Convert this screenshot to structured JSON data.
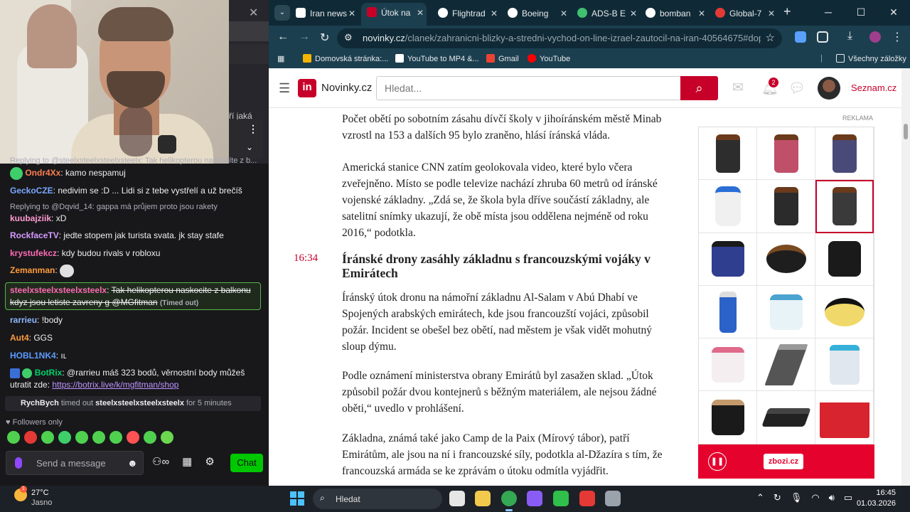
{
  "chat": {
    "pinned_fragment": "ří jaká",
    "pinned_menu_icon": "more-vertical-icon",
    "messages": [
      {
        "reply_to": "Replying to @steelxsteelxsteelxsteelx: Tak helikopterou naskočíte z b...",
        "user": "Ondr4Xx",
        "color": "#ff7f50",
        "text": "kamo nespamuj"
      },
      {
        "user": "GeckoCZE",
        "color": "#7aa7ff",
        "text": "nedivim se :D ... Lidi si z tebe vystřelí a už brečíš"
      },
      {
        "reply_to": "Replying to @Dqvid_14: gappa má průjem proto jsou rakety",
        "user": "kuubajziik",
        "color": "#ff9bd1",
        "text": "xD"
      },
      {
        "user": "RockfaceTV",
        "color": "#d59bff",
        "text": "jedte stopem jak turista svata. jk stay stafe"
      },
      {
        "user": "krystufekcz",
        "color": "#ff6bb5",
        "text": "kdy budou rivals v robloxu"
      },
      {
        "user": "Zemanman",
        "color": "#ff9b3a",
        "text": ""
      },
      {
        "user": "rarrieu",
        "color": "#8fb8ff",
        "text": "!body"
      },
      {
        "user": "Aut4",
        "color": "#ff9b3a",
        "text": "GGS"
      },
      {
        "user": "HOBL1NK4",
        "color": "#5c9bff",
        "text": "ıʟ"
      }
    ],
    "highlight": {
      "user": "steelxsteelxsteelxsteelx",
      "color": "#ff69b4",
      "text_line1": "Tak helikopterou naskocite z balkonu",
      "text_line2": "kdyz jsou letiste zavreny g @MGfitman",
      "tag": "(Timed out)"
    },
    "botrix": {
      "user": "BotRix",
      "color": "#00d26a",
      "text": "@rarrieu máš 323 bodů, věrnostní body můžeš",
      "text2": "utratit zde:",
      "link": "https://botrix.live/k/mgfitman/shop"
    },
    "timeout_notice": {
      "user": "RychBych",
      "mid": "timed out",
      "target": "steelxsteelxsteelxsteelx",
      "tail": "for 5 minutes"
    },
    "followers_only": "Followers only",
    "input_placeholder": "Send a message",
    "chat_button": "Chat",
    "icons": [
      "emote-picker-icon",
      "bits-icon",
      "store-icon",
      "settings-icon"
    ],
    "emote_colors": [
      "#4fd14f",
      "#e53935",
      "#4fd14f",
      "#3ecf6b",
      "#4fd14f",
      "#4fd14f",
      "#4fd14f",
      "#ff5252",
      "#4fd14f",
      "#6bd84f"
    ]
  },
  "browser": {
    "tabs": [
      {
        "label": "Iran news",
        "fav_color": "#ffffff"
      },
      {
        "label": "Útok na",
        "fav_color": "#c7002a",
        "active": true
      },
      {
        "label": "Flightrad",
        "fav_color": "#ffffff"
      },
      {
        "label": "Boeing",
        "fav_color": "#ffffff"
      },
      {
        "label": "ADS-B E",
        "fav_color": "#3fbf6f"
      },
      {
        "label": "bomban",
        "fav_color": "#ffffff"
      },
      {
        "label": "Global-7",
        "fav_color": "#e53935"
      }
    ],
    "url_host": "novinky.cz",
    "url_path": "/clanek/zahranicni-blizky-a-stredni-vychod-on-line-izrael-zautocil-na-iran-40564675#dop_ab_va...",
    "bookmarks": [
      {
        "label": "Domovská stránka:...",
        "color": "#f4b400"
      },
      {
        "label": "YouTube to MP4 &...",
        "color": "#ffffff"
      },
      {
        "label": "Gmail",
        "color": "#ea4335"
      },
      {
        "label": "YouTube",
        "color": "#ff0000"
      }
    ],
    "bookmarks_all": "Všechny záložky"
  },
  "site": {
    "logo_letters": "in",
    "logo_text": "Novinky.cz",
    "search_placeholder": "Hledat...",
    "notifications": "2",
    "seznam": "Seznam.cz"
  },
  "article": {
    "p1": "Počet obětí po sobotním zásahu dívčí školy v jihoíránském městě Minab vzrostl na 153 a dalších 95 bylo zraněno, hlásí íránská vláda.",
    "p2": "Americká stanice CNN zatím geolokovala video, které bylo včera zveřejněno. Místo se podle televize nachází zhruba 60 metrů od íránské vojenské základny. „Zdá se, že škola byla dříve součástí základny, ale satelitní snímky ukazují, že obě místa jsou oddělena nejméně od roku 2016,“ podotkla.",
    "time": "16:34",
    "headline": "Íránské drony zasáhly základnu s francouzskými vojáky v Emirátech",
    "p3": "Íránský útok dronu na námořní základnu Al-Salam v Abú Dhabí ve Spojených arabských emirátech, kde jsou francouzští vojáci, způsobil požár. Incident se obešel bez obětí, nad městem je však vidět mohutný sloup dýmu.",
    "p4": "Podle oznámení ministerstva obrany Emirátů byl zasažen sklad. „Útok způsobil požár dvou kontejnerů s běžným materiálem, ale nejsou žádné oběti,“ uvedlo v prohlášení.",
    "p5": "Základna, známá také jako Camp de la Paix (Mírový tábor), patří Emirátům, ale jsou na ní i francouzské síly, podotkla al-Džazíra s tím, že francouzská armáda se ke zprávám o útoku odmítla vyjádřit."
  },
  "ad": {
    "label": "REKLAMA",
    "brand": "zbozi.cz",
    "products": [
      {
        "kind": "jar",
        "color": "#2d2d2d",
        "lid": "#6a3a1a"
      },
      {
        "kind": "jar",
        "color": "#c0506a",
        "lid": "#6a3a1a"
      },
      {
        "kind": "jar",
        "color": "#4a4a78",
        "lid": "#6a3a1a"
      },
      {
        "kind": "bottle",
        "color": "#f0f0f0",
        "lid": "#2a6fd6"
      },
      {
        "kind": "jar",
        "color": "#2b2b2b",
        "lid": "#6a3a1a"
      },
      {
        "kind": "jar",
        "color": "#3a3a3a",
        "lid": "#6a3a1a"
      },
      {
        "kind": "tub",
        "color": "#2f3e8f",
        "lid": "#1a1a1a"
      },
      {
        "kind": "round",
        "color": "#1e1e1e",
        "lid": "#7a4a20"
      },
      {
        "kind": "tub",
        "color": "#1a1a1a",
        "lid": "#1a1a1a"
      },
      {
        "kind": "remote",
        "color": "#2a62c8",
        "lid": "#dddddd"
      },
      {
        "kind": "tub",
        "color": "#e8f3f7",
        "lid": "#4aa3d0"
      },
      {
        "kind": "round",
        "color": "#f0d96a",
        "lid": "#111111"
      },
      {
        "kind": "tub",
        "color": "#f4eef0",
        "lid": "#e06a8a"
      },
      {
        "kind": "machine",
        "color": "#555555",
        "lid": "#999999"
      },
      {
        "kind": "bag",
        "color": "#e0e7ee",
        "lid": "#35b0d8"
      },
      {
        "kind": "tub",
        "color": "#1a1a1a",
        "lid": "#c49a6c"
      },
      {
        "kind": "pad",
        "color": "#222222",
        "lid": "#444444"
      },
      {
        "kind": "box",
        "color": "#d8242e",
        "lid": "#ffffff"
      }
    ]
  },
  "taskbar": {
    "temperature": "27°C",
    "weather_desc": "Jasno",
    "weather_badge": "1",
    "search_placeholder": "Hledat",
    "time": "16:45",
    "date": "01.03.2026",
    "apps": [
      {
        "name": "task-view-icon",
        "color": "#e6e6e6"
      },
      {
        "name": "file-explorer-icon",
        "color": "#f2c94c"
      },
      {
        "name": "chrome-icon",
        "color": "#34a853",
        "active": true
      },
      {
        "name": "app-purple-icon",
        "color": "#8a5cf6"
      },
      {
        "name": "xbox-icon",
        "color": "#2fbf4a"
      },
      {
        "name": "app-red-icon",
        "color": "#e53935"
      },
      {
        "name": "settings-icon",
        "color": "#9aa3ab"
      }
    ]
  }
}
